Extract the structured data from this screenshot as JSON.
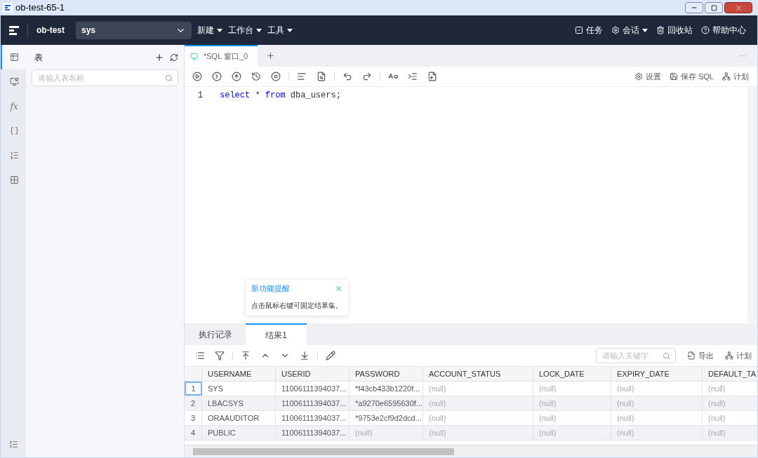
{
  "window": {
    "title": "ob-test-65-1"
  },
  "nav": {
    "connection": "ob-test",
    "tenant": "sys",
    "menus": [
      {
        "label": "新建"
      },
      {
        "label": "工作台"
      },
      {
        "label": "工具"
      }
    ],
    "actions": [
      {
        "kind": "task",
        "label": "任务",
        "dropdown": false
      },
      {
        "kind": "session",
        "label": "会话",
        "dropdown": true
      },
      {
        "kind": "trash",
        "label": "回收站",
        "dropdown": false
      },
      {
        "kind": "help",
        "label": "帮助中心",
        "dropdown": false
      }
    ]
  },
  "rail": [
    {
      "kind": "table",
      "selected": true
    },
    {
      "kind": "view",
      "selected": false
    },
    {
      "kind": "function",
      "label": "fx",
      "selected": false
    },
    {
      "kind": "procedure",
      "selected": false
    },
    {
      "kind": "sequence",
      "selected": false
    },
    {
      "kind": "synonym",
      "selected": false
    }
  ],
  "side_panel": {
    "title": "表",
    "search": {
      "placeholder": "请输入表名称"
    }
  },
  "editor_tabs": [
    {
      "label": "*SQL 窗口_0",
      "selected": true
    }
  ],
  "more": "···",
  "toolbar_right": [
    {
      "kind": "settings",
      "label": "设置"
    },
    {
      "kind": "save",
      "label": "保存 SQL"
    },
    {
      "kind": "plan",
      "label": "计划"
    }
  ],
  "code": [
    {
      "line": "1",
      "tokens": [
        {
          "text": "select",
          "kw": true
        },
        {
          "text": " * ",
          "kw": false
        },
        {
          "text": "from",
          "kw": true
        },
        {
          "text": " dba_users;",
          "kw": false
        }
      ]
    }
  ],
  "popover": {
    "title": "新功能提醒",
    "text": "点击鼠标右键可固定结果集。"
  },
  "result_tabs": [
    {
      "label": "执行记录",
      "selected": false
    },
    {
      "label": "结果1",
      "selected": true
    }
  ],
  "result_toolbar": {
    "search": {
      "placeholder": "请输入关键字"
    },
    "actions": [
      {
        "kind": "export",
        "label": "导出"
      },
      {
        "kind": "plan",
        "label": "计划"
      }
    ]
  },
  "table": {
    "columns": [
      "USERNAME",
      "USERID",
      "PASSWORD",
      "ACCOUNT_STATUS",
      "LOCK_DATE",
      "EXPIRY_DATE",
      "DEFAULT_TA"
    ],
    "rows": [
      {
        "num": "1",
        "selected": true,
        "cells": [
          {
            "text": "SYS",
            "is_null": false
          },
          {
            "text": "11006111394037...",
            "is_null": false
          },
          {
            "text": "*f43cb433b1220f...",
            "is_null": false
          },
          {
            "text": "(null)",
            "is_null": true
          },
          {
            "text": "(null)",
            "is_null": true
          },
          {
            "text": "(null)",
            "is_null": true
          },
          {
            "text": "(null)",
            "is_null": true
          }
        ]
      },
      {
        "num": "2",
        "selected": false,
        "cells": [
          {
            "text": "LBACSYS",
            "is_null": false
          },
          {
            "text": "11006111394037...",
            "is_null": false
          },
          {
            "text": "*a9270e6595630f...",
            "is_null": false
          },
          {
            "text": "(null)",
            "is_null": true
          },
          {
            "text": "(null)",
            "is_null": true
          },
          {
            "text": "(null)",
            "is_null": true
          },
          {
            "text": "(null)",
            "is_null": true
          }
        ]
      },
      {
        "num": "3",
        "selected": false,
        "cells": [
          {
            "text": "ORAAUDITOR",
            "is_null": false
          },
          {
            "text": "11006111394037...",
            "is_null": false
          },
          {
            "text": "*9753e2cf9d2dcd...",
            "is_null": false
          },
          {
            "text": "(null)",
            "is_null": true
          },
          {
            "text": "(null)",
            "is_null": true
          },
          {
            "text": "(null)",
            "is_null": true
          },
          {
            "text": "(null)",
            "is_null": true
          }
        ]
      },
      {
        "num": "4",
        "selected": false,
        "cells": [
          {
            "text": "PUBLIC",
            "is_null": false
          },
          {
            "text": "11006111394037...",
            "is_null": false
          },
          {
            "text": "(null)",
            "is_null": true
          },
          {
            "text": "(null)",
            "is_null": true
          },
          {
            "text": "(null)",
            "is_null": true
          },
          {
            "text": "(null)",
            "is_null": true
          },
          {
            "text": "(null)",
            "is_null": true
          }
        ]
      }
    ]
  }
}
